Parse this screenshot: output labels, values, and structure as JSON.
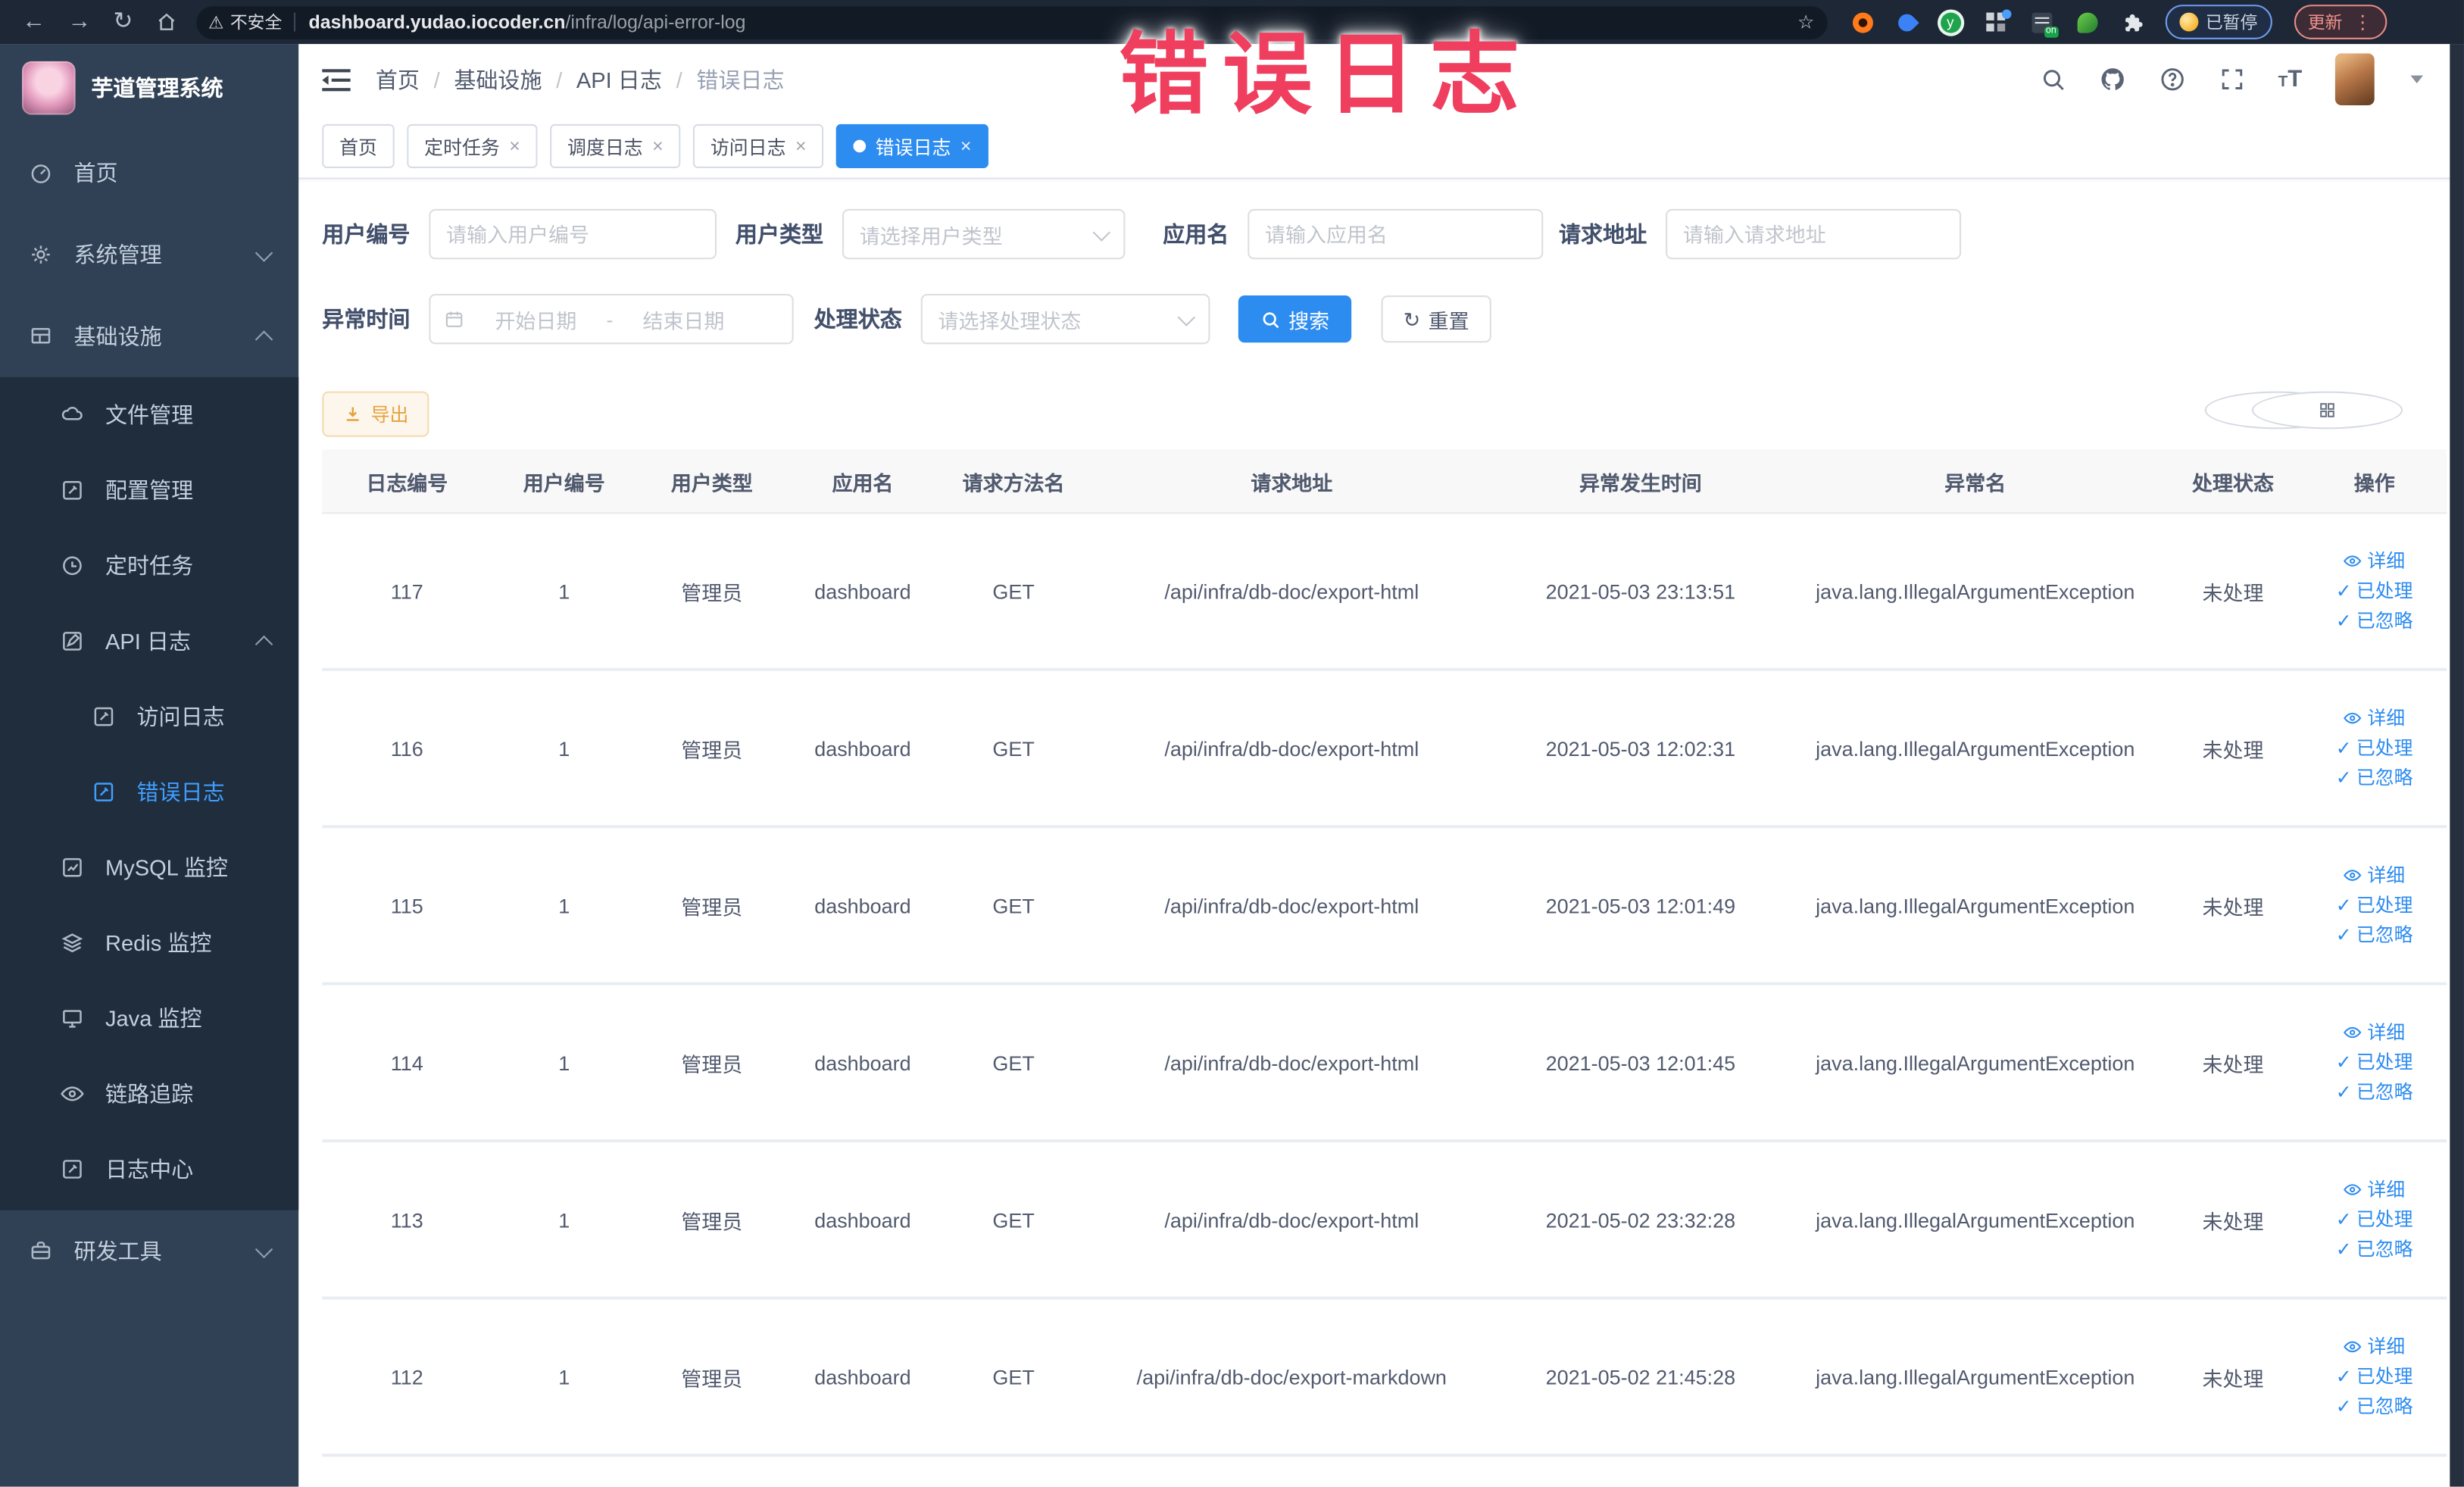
{
  "colors": {
    "accent": "#2d8cf0",
    "sidebar_bg": "#304156",
    "sidebar_submenu_bg": "#1f2d3d",
    "sidebar_active": "#409eff",
    "tab_active_bg": "#2d8cf0",
    "warning_button_text": "#e6a23c",
    "overlay_text": "#ef3e5e",
    "browser_toolbar_bg": "#1d2735"
  },
  "browser": {
    "security_label": "不安全",
    "url_domain": "dashboard.yudao.iocoder.cn",
    "url_path": "/infra/log/api-error-log",
    "paused_label": "已暂停",
    "update_label": "更新"
  },
  "overlay": {
    "text": "错误日志"
  },
  "sidebar": {
    "title": "芋道管理系统",
    "home": "首页",
    "system": "系统管理",
    "infra": "基础设施",
    "file": "文件管理",
    "config": "配置管理",
    "job": "定时任务",
    "apilog": "API 日志",
    "accesslog": "访问日志",
    "errorlog": "错误日志",
    "mysql": "MySQL 监控",
    "redis": "Redis 监控",
    "java": "Java 监控",
    "trace": "链路追踪",
    "logcenter": "日志中心",
    "devtools": "研发工具"
  },
  "breadcrumb": {
    "items": [
      "首页",
      "基础设施",
      "API 日志",
      "错误日志"
    ]
  },
  "tabs": [
    {
      "label": "首页"
    },
    {
      "label": "定时任务"
    },
    {
      "label": "调度日志"
    },
    {
      "label": "访问日志"
    },
    {
      "label": "错误日志"
    }
  ],
  "filters": {
    "user_id": {
      "label": "用户编号",
      "placeholder": "请输入用户编号"
    },
    "user_type": {
      "label": "用户类型",
      "placeholder": "请选择用户类型"
    },
    "app_name": {
      "label": "应用名",
      "placeholder": "请输入应用名"
    },
    "request_url": {
      "label": "请求地址",
      "placeholder": "请输入请求地址"
    },
    "exception_time": {
      "label": "异常时间",
      "start_placeholder": "开始日期",
      "separator": "-",
      "end_placeholder": "结束日期"
    },
    "process_status": {
      "label": "处理状态",
      "placeholder": "请选择处理状态"
    },
    "search_label": "搜索",
    "reset_label": "重置"
  },
  "toolbar": {
    "export_label": "导出"
  },
  "table": {
    "columns": [
      "日志编号",
      "用户编号",
      "用户类型",
      "应用名",
      "请求方法名",
      "请求地址",
      "异常发生时间",
      "异常名",
      "处理状态",
      "操作"
    ],
    "column_keys": [
      "log-id",
      "user-id",
      "user-type",
      "app-name",
      "request-method",
      "request-url",
      "exception-time",
      "exception-name",
      "process-status",
      "actions"
    ],
    "row_actions": [
      {
        "key": "detail",
        "label": "详细",
        "icon": "eye-icon"
      },
      {
        "key": "processed",
        "label": "已处理",
        "icon": "check-icon"
      },
      {
        "key": "ignored",
        "label": "已忽略",
        "icon": "check-icon"
      }
    ],
    "rows": [
      [
        "117",
        "1",
        "管理员",
        "dashboard",
        "GET",
        "/api/infra/db-doc/export-html",
        "2021-05-03 23:13:51",
        "java.lang.IllegalArgumentException",
        "未处理"
      ],
      [
        "116",
        "1",
        "管理员",
        "dashboard",
        "GET",
        "/api/infra/db-doc/export-html",
        "2021-05-03 12:02:31",
        "java.lang.IllegalArgumentException",
        "未处理"
      ],
      [
        "115",
        "1",
        "管理员",
        "dashboard",
        "GET",
        "/api/infra/db-doc/export-html",
        "2021-05-03 12:01:49",
        "java.lang.IllegalArgumentException",
        "未处理"
      ],
      [
        "114",
        "1",
        "管理员",
        "dashboard",
        "GET",
        "/api/infra/db-doc/export-html",
        "2021-05-03 12:01:45",
        "java.lang.IllegalArgumentException",
        "未处理"
      ],
      [
        "113",
        "1",
        "管理员",
        "dashboard",
        "GET",
        "/api/infra/db-doc/export-html",
        "2021-05-02 23:32:28",
        "java.lang.IllegalArgumentException",
        "未处理"
      ],
      [
        "112",
        "1",
        "管理员",
        "dashboard",
        "GET",
        "/api/infra/db-doc/export-markdown",
        "2021-05-02 21:45:28",
        "java.lang.IllegalArgumentException",
        "未处理"
      ]
    ]
  }
}
